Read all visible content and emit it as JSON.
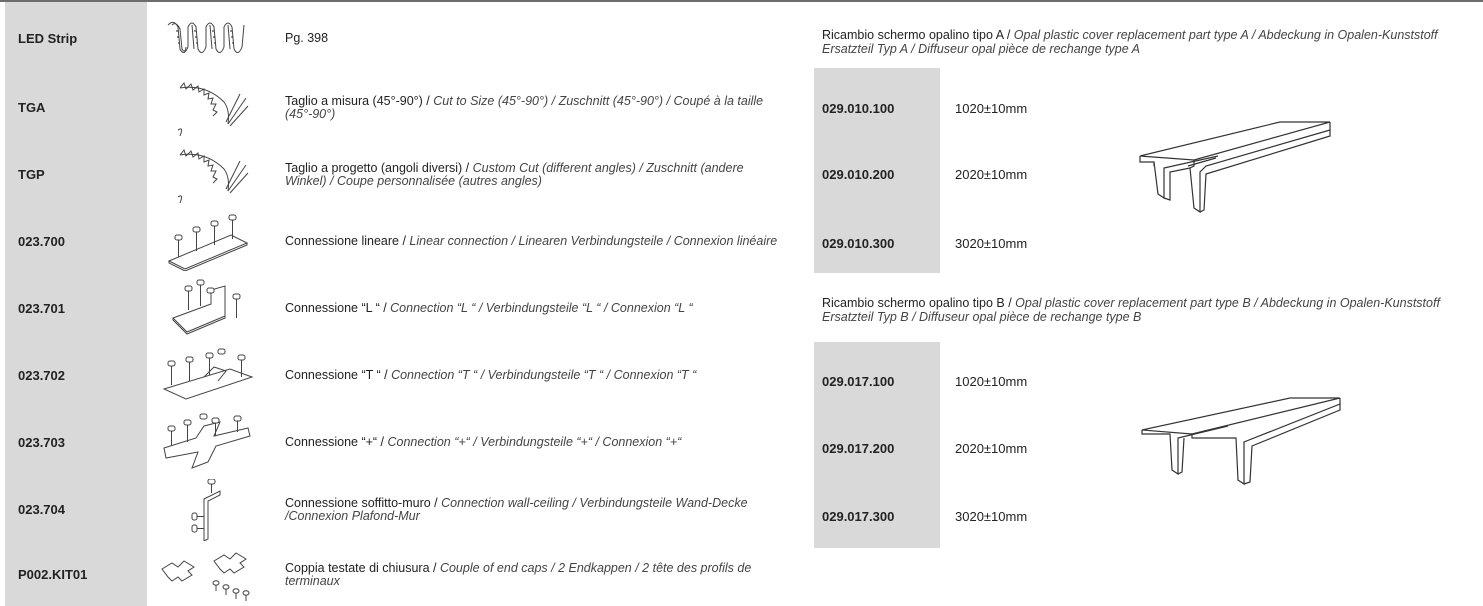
{
  "rows": [
    {
      "code": "LED Strip",
      "icon": "led-strip-icon",
      "title": "Pg. 398",
      "text": ""
    },
    {
      "code": "TGA",
      "icon": "saw-blade-icon",
      "title": "Taglio a misura (45°-90°) / ",
      "text": "Cut to Size (45°-90°) / Zuschnitt (45°-90°) / Coupé à la taille (45°-90°)"
    },
    {
      "code": "TGP",
      "icon": "saw-blade-icon",
      "title": "Taglio a progetto (angoli diversi) / ",
      "text": "Custom Cut (different angles) / Zuschnitt (andere Winkel) / Coupe personnalisée (autres angles)"
    },
    {
      "code": "023.700",
      "icon": "linear-connector-icon",
      "title": "Connessione lineare / ",
      "text": "Linear connection / Linearen Verbindungsteile / Connexion linéaire"
    },
    {
      "code": "023.701",
      "icon": "l-connector-icon",
      "title": "Connessione “L “ / ",
      "text": "Connection “L “ / Verbindungsteile “L “ / Connexion “L “"
    },
    {
      "code": "023.702",
      "icon": "t-connector-icon",
      "title": "Connessione “T “ / ",
      "text": "Connection “T “ / Verbindungsteile “T “ / Connexion “T “"
    },
    {
      "code": "023.703",
      "icon": "plus-connector-icon",
      "title": "Connessione “+“ / ",
      "text": "Connection “+“ / Verbindungsteile “+“ / Connexion “+“"
    },
    {
      "code": "023.704",
      "icon": "wall-ceiling-connector-icon",
      "title": "Connessione soffitto-muro / ",
      "text": "Connection wall-ceiling / Verbindungsteile Wand-Decke /Connexion Plafond-Mur"
    },
    {
      "code": "P002.KIT01",
      "icon": "end-caps-icon",
      "title": "Coppia testate di chiusura / ",
      "text": "Couple of end caps / 2 Endkappen / 2 tête des profils de terminaux"
    }
  ],
  "sectionA": {
    "title": "Ricambio schermo opalino tipo A / ",
    "text": "Opal plastic cover replacement part type A / Abdeckung in Opalen-Kunststoff Ersatzteil Typ A / Diffuseur opal pièce de rechange type A",
    "items": [
      {
        "code": "029.010.100",
        "length": "1020±10mm"
      },
      {
        "code": "029.010.200",
        "length": "2020±10mm"
      },
      {
        "code": "029.010.300",
        "length": "3020±10mm"
      }
    ]
  },
  "sectionB": {
    "title": "Ricambio schermo opalino tipo B / ",
    "text": "Opal plastic cover replacement part type B / Abdeckung in Opalen-Kunststoff Ersatzteil Typ B / Diffuseur opal pièce de rechange type B",
    "items": [
      {
        "code": "029.017.100",
        "length": "1020±10mm"
      },
      {
        "code": "029.017.200",
        "length": "2020±10mm"
      },
      {
        "code": "029.017.300",
        "length": "3020±10mm"
      }
    ]
  },
  "colors": {
    "gray_cell": "#d9d9d9",
    "top_rule": "#6d6d6d"
  }
}
